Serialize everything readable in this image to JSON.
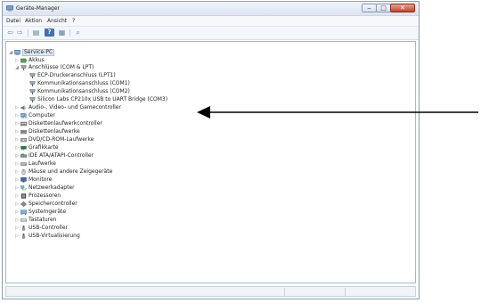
{
  "window": {
    "title": "Geräte-Manager",
    "controls": {
      "minimize": "‒",
      "maximize": "□",
      "close": "✕"
    }
  },
  "menu": {
    "items": [
      "Datei",
      "Aktion",
      "Ansicht",
      "?"
    ]
  },
  "toolbar": {
    "buttons": [
      {
        "icon": "back-arrow-icon",
        "glyph": "⇦"
      },
      {
        "icon": "forward-arrow-icon",
        "glyph": "⇨"
      },
      {
        "icon": "show-hide-tree-icon",
        "glyph": "▤"
      },
      {
        "icon": "help-icon",
        "glyph": "?"
      },
      {
        "icon": "properties-icon",
        "glyph": "▦"
      },
      {
        "icon": "scan-hardware-icon",
        "glyph": "⌕"
      }
    ]
  },
  "tree": {
    "root": "Service-PC",
    "nodes": [
      {
        "label": "Akkus",
        "icon": "battery-icon",
        "color": "#3c9a3c"
      },
      {
        "label": "Anschlüsse (COM & LPT)",
        "icon": "port-icon",
        "color": "#7b8794",
        "expanded": true,
        "children": [
          {
            "label": "ECP-Druckeranschluss (LPT1)",
            "icon": "port-icon"
          },
          {
            "label": "Kommunikationsanschluss (COM1)",
            "icon": "port-icon"
          },
          {
            "label": "Kommunikationsanschluss (COM2)",
            "icon": "port-icon"
          },
          {
            "label": "Silicon Labs CP210x USB to UART Bridge (COM3)",
            "icon": "port-icon"
          }
        ]
      },
      {
        "label": "Audio-, Video- und Gamecontroller",
        "icon": "speaker-icon",
        "color": "#6a7480"
      },
      {
        "label": "Computer",
        "icon": "computer-icon",
        "color": "#3d6fb0"
      },
      {
        "label": "Diskettenlaufwerkcontroller",
        "icon": "floppy-controller-icon",
        "color": "#7a7a7a"
      },
      {
        "label": "Diskettenlaufwerke",
        "icon": "floppy-drive-icon",
        "color": "#7a7a7a"
      },
      {
        "label": "DVD/CD-ROM-Laufwerke",
        "icon": "disc-drive-icon",
        "color": "#8d8d8d"
      },
      {
        "label": "Grafikkarte",
        "icon": "display-adapter-icon",
        "color": "#2f6e3f"
      },
      {
        "label": "IDE ATA/ATAPI-Controller",
        "icon": "ide-controller-icon",
        "color": "#7a7a7a"
      },
      {
        "label": "Laufwerke",
        "icon": "hard-drive-icon",
        "color": "#8d8d8d"
      },
      {
        "label": "Mäuse und andere Zeigegeräte",
        "icon": "mouse-icon",
        "color": "#6a6a6a"
      },
      {
        "label": "Monitore",
        "icon": "monitor-icon",
        "color": "#3d6fb0"
      },
      {
        "label": "Netzwerkadapter",
        "icon": "network-adapter-icon",
        "color": "#3c8a3c"
      },
      {
        "label": "Prozessoren",
        "icon": "processor-icon",
        "color": "#555555"
      },
      {
        "label": "Speichercontroller",
        "icon": "storage-controller-icon",
        "color": "#555555"
      },
      {
        "label": "Systemgeräte",
        "icon": "system-devices-icon",
        "color": "#3d6fb0"
      },
      {
        "label": "Tastaturen",
        "icon": "keyboard-icon",
        "color": "#6a6a6a"
      },
      {
        "label": "USB-Controller",
        "icon": "usb-icon",
        "color": "#555555"
      },
      {
        "label": "USB-Virtualisierung",
        "icon": "usb-icon",
        "color": "#555555"
      }
    ]
  },
  "annotation": {
    "arrow": "pointer-arrow",
    "points_to": "Silicon Labs CP210x USB to UART Bridge (COM3)"
  },
  "colors": {
    "title_bar": "#dbe5f1",
    "close_button": "#c6432a",
    "selection": "#dfe9f6"
  }
}
